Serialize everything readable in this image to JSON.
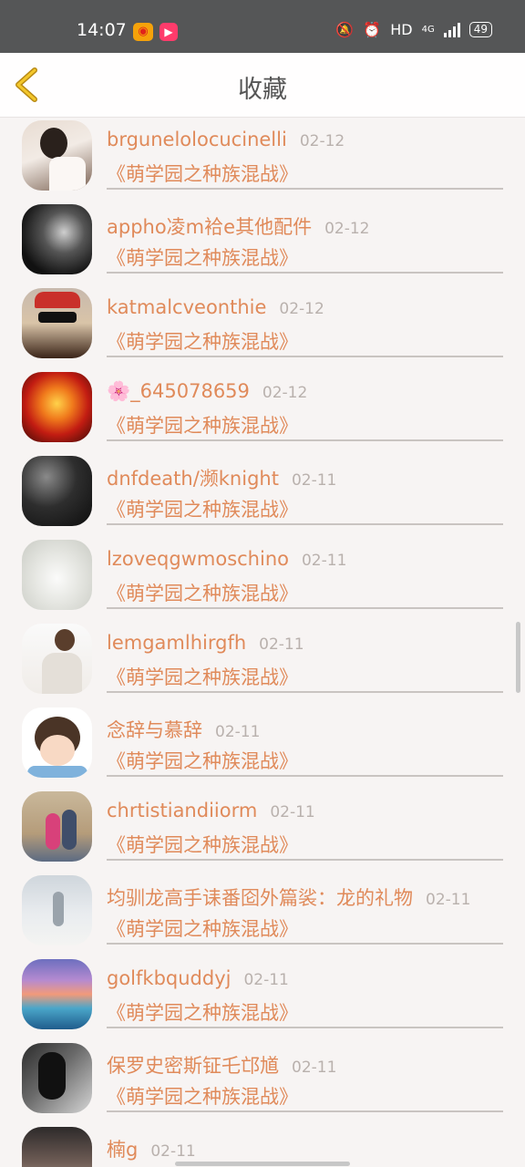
{
  "status_bar": {
    "time": "14:07",
    "hd": "HD",
    "network": "4G",
    "battery": "49"
  },
  "header": {
    "title": "收藏",
    "back_icon": "chevron-left-icon"
  },
  "items": [
    {
      "name": "brgunelolocucinelli",
      "date": "02-12",
      "subtitle": "《萌学园之种族混战》"
    },
    {
      "name": "appho凌m袷e其他配件",
      "date": "02-12",
      "subtitle": "《萌学园之种族混战》"
    },
    {
      "name": "katmalcveonthie",
      "date": "02-12",
      "subtitle": "《萌学园之种族混战》"
    },
    {
      "name": "🌸_645078659",
      "date": "02-12",
      "subtitle": "《萌学园之种族混战》"
    },
    {
      "name": "dnfdeath/濒knight",
      "date": "02-11",
      "subtitle": "《萌学园之种族混战》"
    },
    {
      "name": "lzoveqgwmoschino",
      "date": "02-11",
      "subtitle": "《萌学园之种族混战》"
    },
    {
      "name": "lemgamlhirgfh",
      "date": "02-11",
      "subtitle": "《萌学园之种族混战》"
    },
    {
      "name": "念辞与慕辞",
      "date": "02-11",
      "subtitle": "《萌学园之种族混战》"
    },
    {
      "name": "chrtistiandiiorm",
      "date": "02-11",
      "subtitle": "《萌学园之种族混战》"
    },
    {
      "name": "均驯龙高手诔番囵外篇裟：龙的礼物",
      "date": "02-11",
      "subtitle": "《萌学园之种族混战》"
    },
    {
      "name": "golfkbquddyj",
      "date": "02-11",
      "subtitle": "《萌学园之种族混战》"
    },
    {
      "name": "保罗史密斯钲乇邙馗",
      "date": "02-11",
      "subtitle": "《萌学园之种族混战》"
    },
    {
      "name": "楠g",
      "date": "02-11",
      "subtitle": ""
    }
  ]
}
